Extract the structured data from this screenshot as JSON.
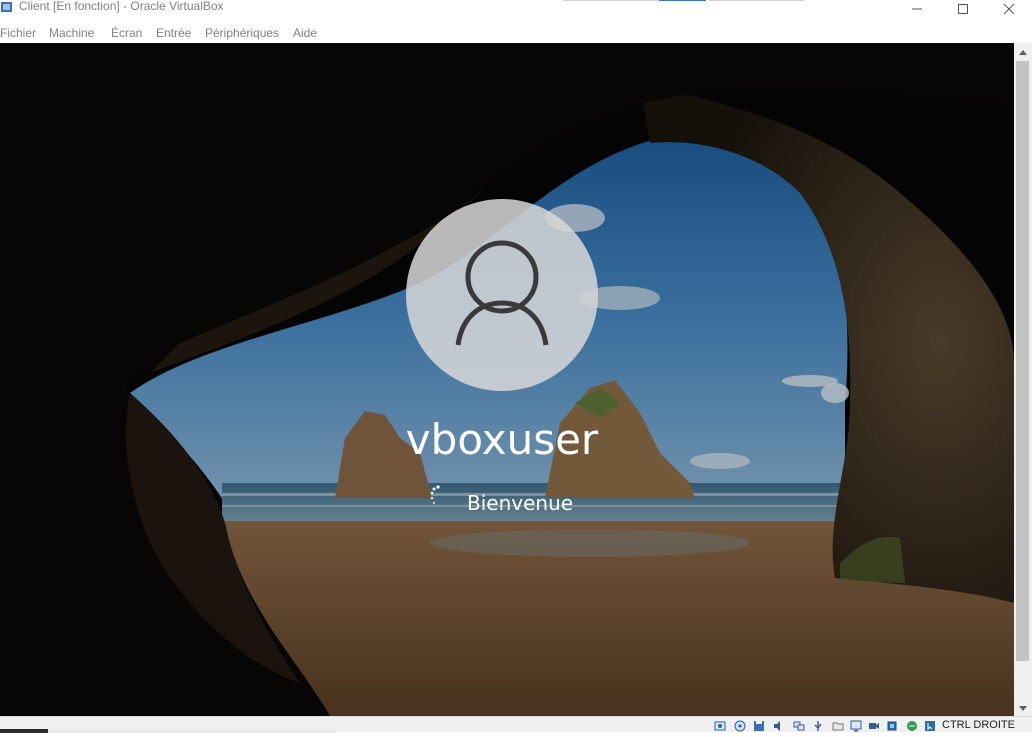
{
  "window": {
    "title": "Client [En fonction] - Oracle VirtualBox",
    "controls": [
      "minimize-icon",
      "maximize-icon",
      "close-icon"
    ]
  },
  "menu": {
    "items": [
      {
        "label": "Fichier"
      },
      {
        "label": "Machine"
      },
      {
        "label": "Écran"
      },
      {
        "label": "Entrée"
      },
      {
        "label": "Périphériques"
      },
      {
        "label": "Aide"
      }
    ]
  },
  "login": {
    "username": "vboxuser",
    "status": "Bienvenue",
    "avatar_icon": "user-icon",
    "spinner_icon": "loading-spinner-icon"
  },
  "statusbar": {
    "icons": [
      "hard-disk-icon",
      "optical-drive-icon",
      "floppy-icon",
      "audio-icon",
      "network-icon",
      "usb-icon",
      "shared-folders-icon",
      "display-icon",
      "recording-icon",
      "cpu-icon",
      "keyboard-capture-icon",
      "mouse-integration-icon"
    ],
    "host_key": "CTRL DROITE"
  },
  "colors": {
    "sky": "#3a7fc4",
    "sand": "#a9784a",
    "rock": "#2c2016",
    "avatar_bg": "#d8d8d8"
  }
}
